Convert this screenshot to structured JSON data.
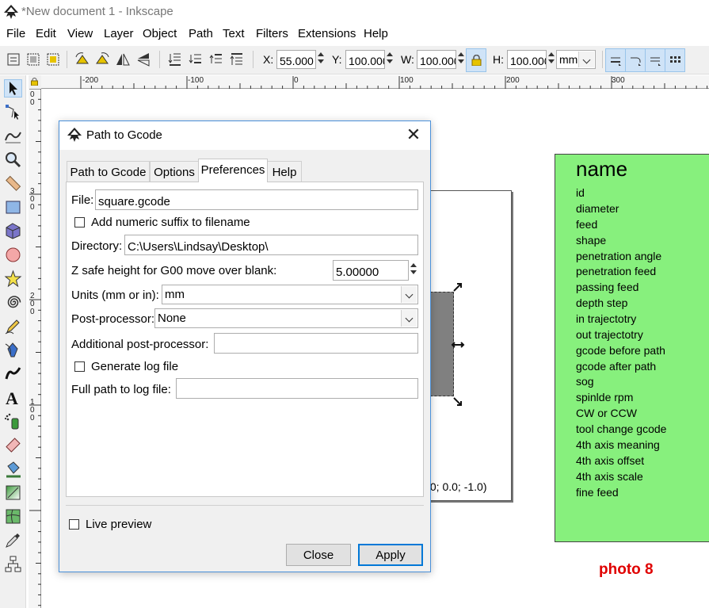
{
  "window": {
    "title": "*New document 1 - Inkscape"
  },
  "menu": [
    "File",
    "Edit",
    "View",
    "Layer",
    "Object",
    "Path",
    "Text",
    "Filters",
    "Extensions",
    "Help"
  ],
  "toolbar": {
    "x_label": "X:",
    "x_value": "55.000",
    "y_label": "Y:",
    "y_value": "100.000",
    "w_label": "W:",
    "w_value": "100.000",
    "h_label": "H:",
    "h_value": "100.000",
    "unit": "mm"
  },
  "ruler": {
    "top": [
      "-200",
      "-100",
      "0",
      "100",
      "200",
      "300"
    ],
    "left": [
      "0",
      "0",
      "3",
      "0",
      "0",
      "2",
      "0",
      "0",
      "1",
      "0",
      "0"
    ]
  },
  "dialog": {
    "title": "Path to Gcode",
    "tabs": [
      "Path to Gcode",
      "Options",
      "Preferences",
      "Help"
    ],
    "active_tab": "Preferences",
    "file_label": "File:",
    "file_value": "square.gcode",
    "numeric_suffix_label": "Add numeric suffix to filename",
    "directory_label": "Directory:",
    "directory_value": "C:\\Users\\Lindsay\\Desktop\\",
    "z_safe_label": "Z safe height for G00 move over blank:",
    "z_safe_value": "5.00000",
    "units_label": "Units (mm or in):",
    "units_value": "mm",
    "post_processor_label": "Post-processor:",
    "post_processor_value": "None",
    "additional_pp_label": "Additional post-processor:",
    "additional_pp_value": "",
    "log_label": "Generate log file",
    "log_path_label": "Full path to log file:",
    "log_path_value": "",
    "live_preview_label": "Live preview",
    "close_label": "Close",
    "apply_label": "Apply"
  },
  "canvas": {
    "coord_text": ".0; 0.0; -1.0)",
    "name_box_title": "name",
    "name_items": [
      "id",
      "diameter",
      "feed",
      "shape",
      "penetration angle",
      "penetration feed",
      "passing feed",
      "depth step",
      "in trajectotry",
      "out trajectotry",
      "gcode before path",
      "gcode after path",
      "sog",
      "spinlde rpm",
      "CW or CCW",
      "tool change gcode",
      "4th axis meaning",
      "4th axis offset",
      "4th axis scale",
      "fine feed"
    ],
    "photo_label": "photo 8"
  },
  "colors": {
    "name_box": "#87f07d",
    "photo_label": "#e00000",
    "accent": "#0078d7",
    "selection_highlight": "#cfe3f7"
  }
}
